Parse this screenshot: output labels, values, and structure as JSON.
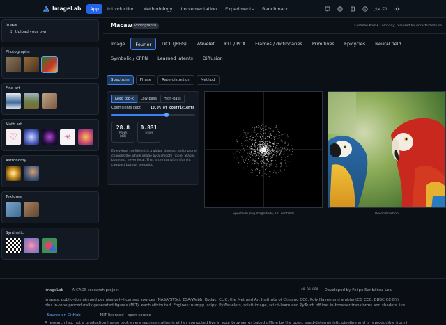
{
  "app": {
    "name": "ImageLab"
  },
  "nav": [
    {
      "label": "App",
      "active": true
    },
    {
      "label": "Introduction",
      "active": false
    },
    {
      "label": "Methodology",
      "active": false
    },
    {
      "label": "Implementation",
      "active": false
    },
    {
      "label": "Experiments",
      "active": false
    },
    {
      "label": "Benchmark",
      "active": false
    }
  ],
  "topbar": {
    "lang": "EN"
  },
  "sidebar": {
    "image_title": "Image",
    "upload_label": "Upload your own",
    "sections": [
      {
        "title": "Photographs",
        "thumbs": [
          "#6b5a44",
          "#7a5b2c",
          "#3a7a2a"
        ]
      },
      {
        "title": "Fine art",
        "thumbs": [
          "#6e8aa6",
          "#6d7f4a",
          "#9b8468"
        ]
      },
      {
        "title": "Math art",
        "thumbs": [
          "#f3e6ea",
          "#5b6fc9",
          "#2a1a4a",
          "#f2eef4",
          "#d8665c"
        ]
      },
      {
        "title": "Astronomy",
        "thumbs": [
          "#b8903a",
          "#566a8a"
        ]
      },
      {
        "title": "Textures",
        "thumbs": [
          "#5d87ad",
          "#8a6a4a"
        ]
      },
      {
        "title": "Synthetic",
        "thumbs": [
          "#777777",
          "#c97aa8",
          "#3f8f5a"
        ]
      }
    ]
  },
  "main": {
    "title": "Macaws",
    "badge": "Photographs",
    "credit": "Eastman Kodak Company; released for unrestricted use",
    "tabs": [
      {
        "label": "Image",
        "active": false
      },
      {
        "label": "Fourier",
        "active": true
      },
      {
        "label": "DCT (JPEG)",
        "active": false
      },
      {
        "label": "Wavelet",
        "active": false
      },
      {
        "label": "KLT / PCA",
        "active": false
      },
      {
        "label": "Frames / dictionaries",
        "active": false
      },
      {
        "label": "Primitives",
        "active": false
      },
      {
        "label": "Epicycles",
        "active": false
      },
      {
        "label": "Neural field",
        "active": false
      },
      {
        "label": "Symbolic / CPPN",
        "active": false
      },
      {
        "label": "Learned latents",
        "active": false
      },
      {
        "label": "Diffusion",
        "active": false
      }
    ],
    "subtabs": [
      {
        "label": "Spectrum",
        "active": true
      },
      {
        "label": "Phase",
        "active": false
      },
      {
        "label": "Rate-distortion",
        "active": false
      },
      {
        "label": "Method",
        "active": false
      }
    ]
  },
  "controls": {
    "modes": [
      {
        "label": "Keep top-k",
        "active": true
      },
      {
        "label": "Low-pass",
        "active": false
      },
      {
        "label": "High-pass",
        "active": false
      }
    ],
    "coeff_label": "Coefficients kept",
    "coeff_value": "10.0% of coefficients",
    "slider_fraction": 0.66,
    "metrics": [
      {
        "value": "28.8",
        "label": "PSNR\n(dB)"
      },
      {
        "value": "0.831",
        "label": "SSIM"
      }
    ],
    "explain": "Every kept coefficient is a global sinusoid: editing one changes the whole image by a smooth ripple. Stable, bounded, never local. That is the transform family: compact but not semantic."
  },
  "captions": {
    "spectrum": "Spectrum (log magnitude, DC centred)",
    "reconstruction": "Reconstruction"
  },
  "footer": {
    "brand": "ImageLab",
    "tagline": "· A CAOS research project ·",
    "version": "v0.00.000",
    "developer": "· Developed by Felipe Sanbáñez-Leal ·",
    "sources": "Images: public-domain and permissively-licensed sources (NASA/STScI, ESA/Webb, Kodak, CLIC, the Met and Art Institute of Chicago CC0, Poly Haven and ambientCG CC0, BBBC CC-BY) plus in-repo procedurally generated figures (MIT), each attributed. Engines: numpy, scipy, PyWavelets, scikit-image, scikit-learn and PyTorch offline; in-browser transforms and shaders live.",
    "github": "Source on GitHub",
    "license": "MIT licensed · open source",
    "notice": "A research lab, not a production image tool: every representation is either computed live in your browser or baked offline by the open, seed-deterministic pipeline and is reproducible from the"
  }
}
